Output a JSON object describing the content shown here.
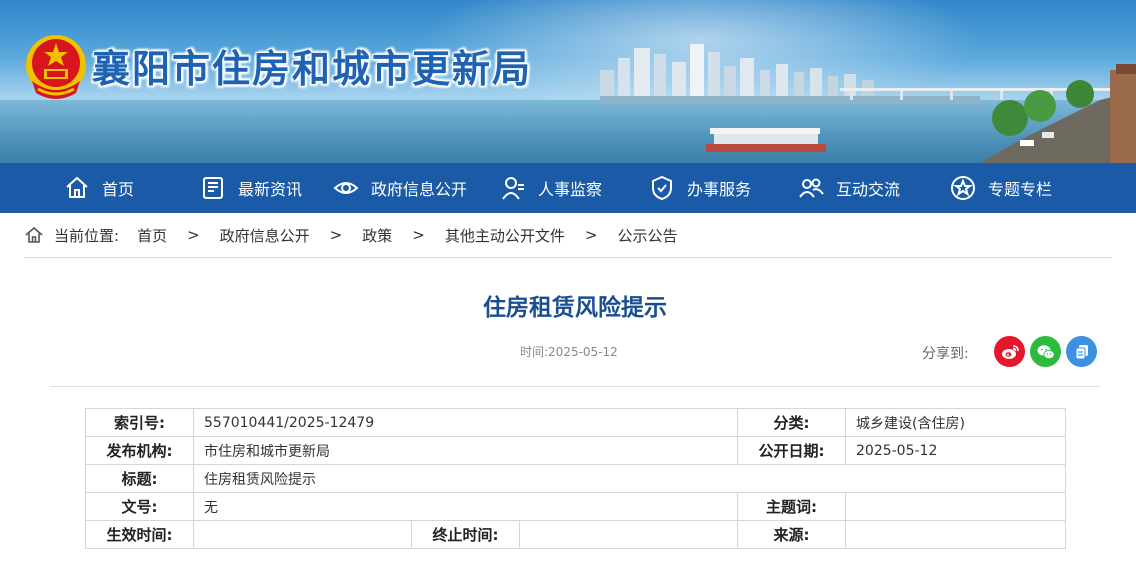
{
  "header": {
    "site_title": "襄阳市住房和城市更新局"
  },
  "nav": {
    "items": [
      {
        "label": "首页",
        "icon": "home-icon"
      },
      {
        "label": "最新资讯",
        "icon": "news-icon"
      },
      {
        "label": "政府信息公开",
        "icon": "eye-icon"
      },
      {
        "label": "人事监察",
        "icon": "person-icon"
      },
      {
        "label": "办事服务",
        "icon": "shield-icon"
      },
      {
        "label": "互动交流",
        "icon": "people-icon"
      },
      {
        "label": "专题专栏",
        "icon": "star-icon"
      }
    ]
  },
  "breadcrumb": {
    "prefix": "当前位置:",
    "items": [
      "首页",
      "政府信息公开",
      "政策",
      "其他主动公开文件",
      "公示公告"
    ],
    "separator": ">"
  },
  "article": {
    "title": "住房租赁风险提示",
    "time_text": "时间:2025-05-12",
    "share_label": "分享到:"
  },
  "share": {
    "buttons": [
      {
        "icon": "weibo-icon",
        "color": "#e6162d"
      },
      {
        "icon": "wechat-icon",
        "color": "#2dbb3f"
      },
      {
        "icon": "copy-icon",
        "color": "#3d8fe0"
      }
    ]
  },
  "info_table": {
    "index_label": "索引号:",
    "index_value": "557010441/2025-12479",
    "category_label": "分类:",
    "category_value": "城乡建设(含住房)",
    "publisher_label": "发布机构:",
    "publisher_value": "市住房和城市更新局",
    "pubdate_label": "公开日期:",
    "pubdate_value": "2025-05-12",
    "title_label": "标题:",
    "title_value": "住房租赁风险提示",
    "docno_label": "文号:",
    "docno_value": "无",
    "keywords_label": "主题词:",
    "keywords_value": "",
    "effective_label": "生效时间:",
    "effective_value": "",
    "expiry_label": "终止时间:",
    "expiry_value": "",
    "source_label": "来源:",
    "source_value": ""
  },
  "colors": {
    "nav_bg": "#1a5aa6",
    "title_blue": "#1a4e8f",
    "site_title_blue": "#1e63b3"
  }
}
